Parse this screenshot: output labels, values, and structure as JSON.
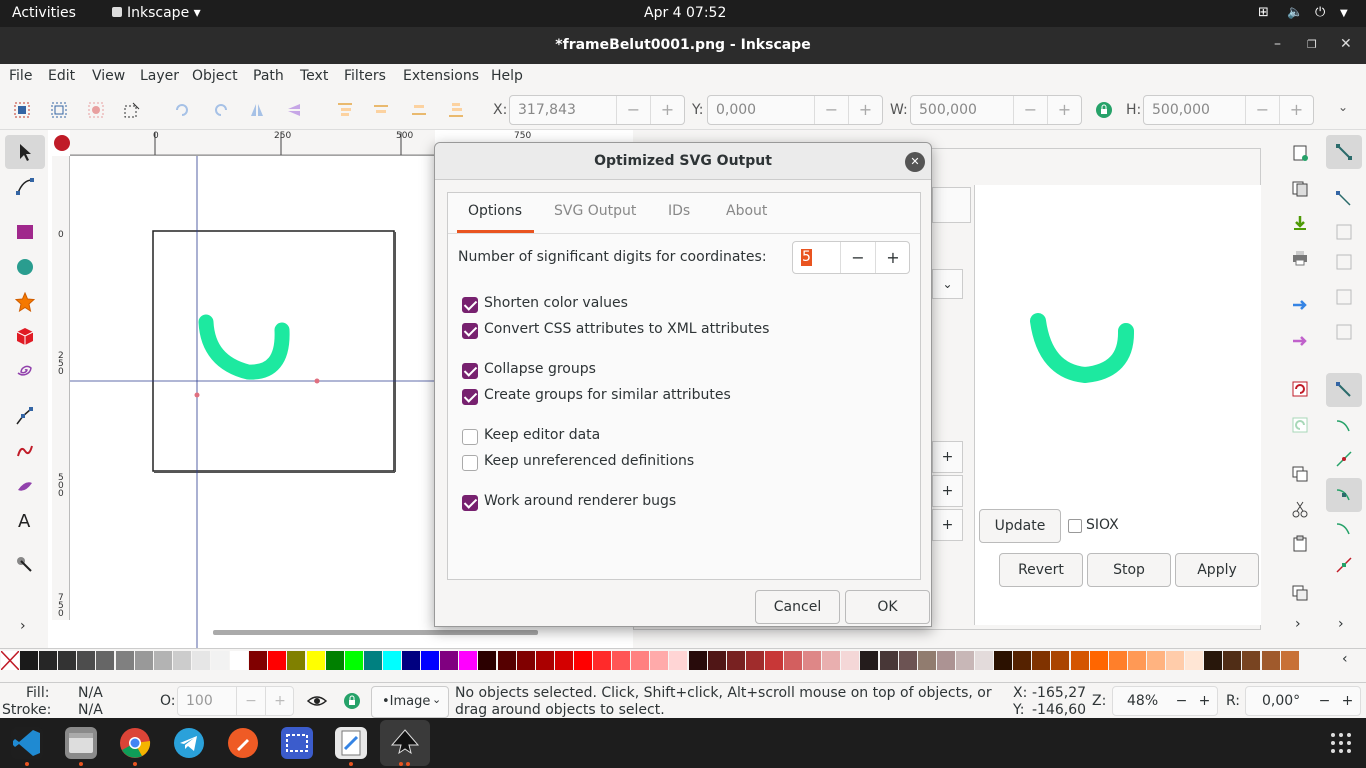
{
  "topbar": {
    "activities": "Activities",
    "app": "Inkscape ▾",
    "clock": "Apr 4  07:52"
  },
  "window": {
    "title": "*frameBelut0001.png - Inkscape"
  },
  "menu": [
    "File",
    "Edit",
    "View",
    "Layer",
    "Object",
    "Path",
    "Text",
    "Filters",
    "Extensions",
    "Help"
  ],
  "toolbar": {
    "x_label": "X:",
    "x_value": "317,843",
    "y_label": "Y:",
    "y_value": "0,000",
    "w_label": "W:",
    "w_value": "500,000",
    "h_label": "H:",
    "h_value": "500,000"
  },
  "rulers": {
    "h": [
      "0",
      "250",
      "500",
      "750"
    ],
    "v": [
      "0",
      "2\n5\n0",
      "5\n0\n0",
      "7\n5\n0"
    ]
  },
  "dialog": {
    "title": "Optimized SVG Output",
    "tabs": [
      "Options",
      "SVG Output",
      "IDs",
      "About"
    ],
    "active_tab": "Options",
    "digits_label": "Number of significant digits for coordinates:",
    "digits_value": "5",
    "options": [
      {
        "label": "Shorten color values",
        "checked": true
      },
      {
        "label": "Convert CSS attributes to XML attributes",
        "checked": true
      },
      {
        "label": "Collapse groups",
        "checked": true
      },
      {
        "label": "Create groups for similar attributes",
        "checked": true
      },
      {
        "label": "Keep editor data",
        "checked": false
      },
      {
        "label": "Keep unreferenced definitions",
        "checked": false
      },
      {
        "label": "Work around renderer bugs",
        "checked": true
      }
    ],
    "cancel": "Cancel",
    "ok": "OK"
  },
  "trace_panel": {
    "update": "Update",
    "siox": "SIOX",
    "revert": "Revert",
    "stop": "Stop",
    "apply": "Apply"
  },
  "status": {
    "fill_label": "Fill:",
    "fill_value": "N/A",
    "stroke_label": "Stroke:",
    "stroke_value": "N/A",
    "opacity_label": "O:",
    "opacity_value": "100",
    "layer": "•Image",
    "message": "No objects selected. Click, Shift+click, Alt+scroll mouse on top of objects, or drag around objects to select.",
    "cursor_x_label": "X:",
    "cursor_x": "-165,27",
    "cursor_y_label": "Y:",
    "cursor_y": "-146,60",
    "zoom_label": "Z:",
    "zoom": "48%",
    "rotation_label": "R:",
    "rotation": "0,00°"
  },
  "colors": {
    "accent": "#77216f",
    "shape": "#1de9a0",
    "tab_underline": "#e95420"
  },
  "palette": [
    "#1a1a1a",
    "#262626",
    "#333333",
    "#4d4d4d",
    "#666666",
    "#808080",
    "#999999",
    "#b3b3b3",
    "#cccccc",
    "#e6e6e6",
    "#f2f2f2",
    "#ffffff",
    "#800000",
    "#ff0000",
    "#808000",
    "#ffff00",
    "#008000",
    "#00ff00",
    "#008080",
    "#00ffff",
    "#000080",
    "#0000ff",
    "#800080",
    "#ff00ff",
    "#2b0000",
    "#550000",
    "#800000",
    "#aa0000",
    "#d40000",
    "#ff0000",
    "#ff2a2a",
    "#ff5555",
    "#ff8080",
    "#ffaaaa",
    "#ffd5d5",
    "#280b0b",
    "#501616",
    "#782121",
    "#a02c2c",
    "#c83737",
    "#d35f5f",
    "#de8787",
    "#e9afaf",
    "#f4d7d7",
    "#241c1c",
    "#483737",
    "#6c5353",
    "#917c6f",
    "#ac9393",
    "#c8b7b7",
    "#e3dbdb",
    "#2b1100",
    "#552200",
    "#803300",
    "#aa4400",
    "#d45500",
    "#ff6600",
    "#ff7f2a",
    "#ff9955",
    "#ffb380",
    "#ffccaa",
    "#ffe6d5",
    "#28170b",
    "#502d16",
    "#784421",
    "#a05a2c",
    "#c87137"
  ]
}
